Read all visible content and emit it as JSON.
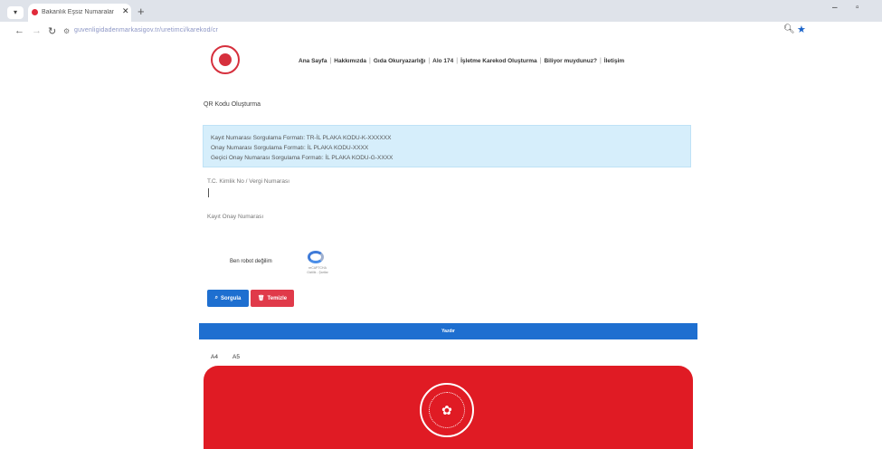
{
  "browser": {
    "tab_title": "Bakanlık Eşsiz Numaralan",
    "url": "guvenligidadenmarkasigov.tr/uretimci/karekod/cr",
    "colors": {
      "tabbar": "#dfe3ea",
      "link": "#8a94c4",
      "star": "#1a63c9"
    }
  },
  "nav": {
    "items": [
      "Ana Sayfa",
      "Hakkımızda",
      "Gıda Okuryazarlığı",
      "Alo 174",
      "İşletme Karekod Oluşturma",
      "Biliyor muydunuz?",
      "İletişim"
    ]
  },
  "page": {
    "title": "QR Kodu Oluşturma",
    "info_lines": [
      "Kayıt Numarası Sorgulama Formatı: TR-İL PLAKA KODU-K-XXXXXX",
      "Onay Numarası Sorgulama Formatı: İL PLAKA KODU-XXXX",
      "Geçici Onay Numarası Sorgulama Formatı: İL PLAKA KODU-G-XXXX"
    ],
    "field1_label": "T.C. Kimlik No / Vergi Numarası",
    "field2_label": "Kayıt Onay Numarası",
    "captcha_label": "Ben robot değilim",
    "captcha_brand": "reCAPTCHA",
    "captcha_links": "Gizlilik - Şartlar",
    "query_button": "Sorgula",
    "clear_button": "Temizle",
    "bar_label": "Yazdır",
    "size_options": [
      "A4",
      "A5"
    ],
    "colors": {
      "primary": "#1e6fd0",
      "danger": "#e03a4a",
      "card": "#e01b24",
      "info_bg": "#d6eefb"
    }
  }
}
